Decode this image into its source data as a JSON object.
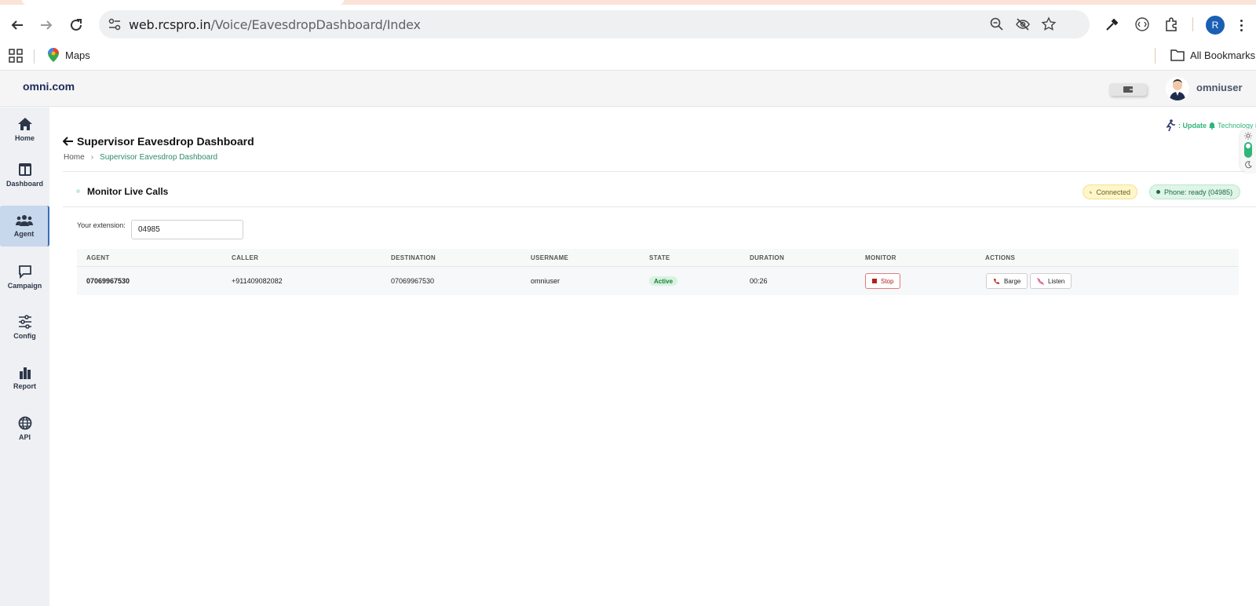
{
  "browser": {
    "url_host": "web.rcspro.in",
    "url_path": "/Voice/EavesdropDashboard/Index",
    "profile_initial": "R",
    "bookmarks": [
      {
        "label": "Maps"
      }
    ],
    "all_bookmarks_label": "All Bookmarks"
  },
  "app": {
    "brand": "omni.com",
    "username": "omniuser"
  },
  "sidebar": {
    "items": [
      {
        "label": "Home",
        "icon": "home-icon"
      },
      {
        "label": "Dashboard",
        "icon": "dashboard-icon"
      },
      {
        "label": "Agent",
        "icon": "agent-icon",
        "active": true
      },
      {
        "label": "Campaign",
        "icon": "campaign-icon"
      },
      {
        "label": "Config",
        "icon": "config-icon"
      },
      {
        "label": "Report",
        "icon": "report-icon"
      },
      {
        "label": "API",
        "icon": "api-icon"
      }
    ]
  },
  "update_bar": {
    "label": ": Update",
    "text": "Technology is best when it b"
  },
  "page": {
    "title": "Supervisor Eavesdrop Dashboard",
    "breadcrumb": {
      "home": "Home",
      "current": "Supervisor Eavesdrop Dashboard"
    }
  },
  "monitor": {
    "title": "Monitor Live Calls",
    "connection_status": "Connected",
    "phone_status": "Phone: ready (04985)",
    "extension_label": "Your extension:",
    "extension_value": "04985"
  },
  "table": {
    "columns": [
      "AGENT",
      "CALLER",
      "DESTINATION",
      "USERNAME",
      "STATE",
      "DURATION",
      "MONITOR",
      "ACTIONS"
    ],
    "rows": [
      {
        "agent": "07069967530",
        "caller": "+911409082082",
        "destination": "07069967530",
        "username": "omniuser",
        "state": "Active",
        "duration": "00:26",
        "monitor_label": "Stop",
        "actions": [
          "Barge",
          "Listen"
        ]
      }
    ]
  },
  "colors": {
    "accent_green": "#2fb57a",
    "active_sidebar": "#c7d7ec",
    "stop_red": "#b42020"
  }
}
